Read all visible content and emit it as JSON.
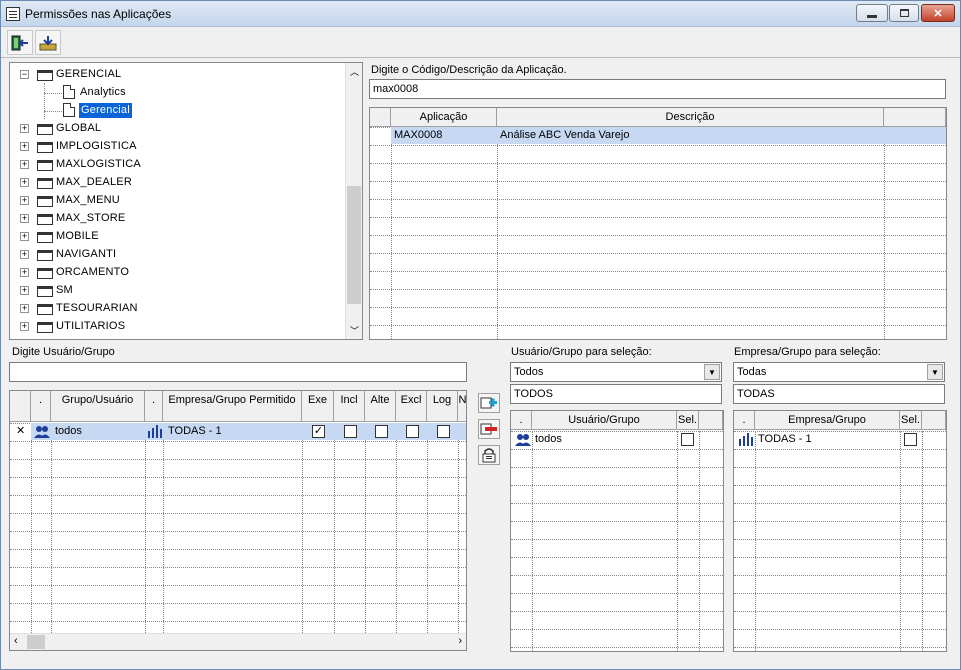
{
  "window": {
    "title": "Permissões nas Aplicações",
    "minimize": "▭",
    "restore": "▫",
    "close": "✕"
  },
  "tree": {
    "items": [
      {
        "label": "GERENCIAL",
        "expanded": true
      },
      {
        "label": "Analytics",
        "child": true
      },
      {
        "label": "Gerencial",
        "child": true,
        "selected": true
      },
      {
        "label": "GLOBAL"
      },
      {
        "label": "IMPLOGISTICA"
      },
      {
        "label": "MAXLOGISTICA"
      },
      {
        "label": "MAX_DEALER"
      },
      {
        "label": "MAX_MENU"
      },
      {
        "label": "MAX_STORE"
      },
      {
        "label": "MOBILE"
      },
      {
        "label": "NAVIGANTI"
      },
      {
        "label": "ORCAMENTO"
      },
      {
        "label": "SM"
      },
      {
        "label": "TESOURARIAN"
      },
      {
        "label": "UTILITARIOS"
      }
    ]
  },
  "app_search": {
    "label": "Digite o Código/Descrição da Aplicação.",
    "value": "max0008"
  },
  "app_grid": {
    "headers": [
      "Aplicação",
      "Descrição"
    ],
    "rows": [
      [
        "MAX0008",
        "Análise ABC Venda Varejo"
      ]
    ]
  },
  "user_search": {
    "label": "Digite Usuário/Grupo",
    "value": ""
  },
  "perm_grid": {
    "headers": [
      ".",
      "Grupo/Usuário",
      ".",
      "Empresa/Grupo Permitido",
      "Exe",
      "Incl",
      "Alte",
      "Excl",
      "Log",
      "N"
    ],
    "rows": [
      {
        "marker": "✕",
        "user": "todos",
        "company": "TODAS - 1",
        "exe": true,
        "incl": false,
        "alte": false,
        "excl": false,
        "log": false
      }
    ]
  },
  "user_select": {
    "label": "Usuário/Grupo para seleção:",
    "dropdown": "Todos",
    "filter": "TODOS",
    "headers": [
      ".",
      "Usuário/Grupo",
      "Sel."
    ],
    "rows": [
      {
        "name": "todos",
        "sel": false
      }
    ]
  },
  "company_select": {
    "label": "Empresa/Grupo para seleção:",
    "dropdown": "Todas",
    "filter": "TODAS",
    "headers": [
      ".",
      "Empresa/Grupo",
      "Sel."
    ],
    "rows": [
      {
        "name": "TODAS - 1",
        "sel": false
      }
    ]
  },
  "icons": {
    "exit": "exit-icon",
    "export": "export-icon",
    "add": "add-permission-icon",
    "remove": "remove-permission-icon",
    "lock": "lock-icon"
  },
  "colors": {
    "selection": "#0a64d8",
    "row_highlight": "#c6d8f2"
  }
}
